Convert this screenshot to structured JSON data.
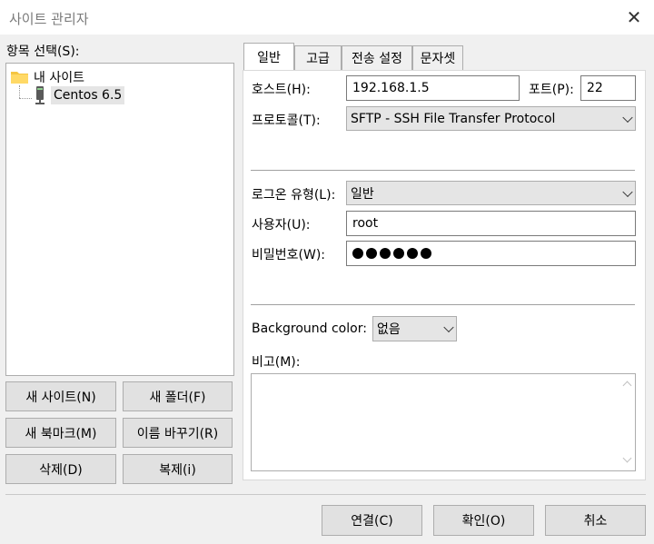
{
  "window": {
    "title": "사이트 관리자"
  },
  "left": {
    "select_label": "항목 선택(S):",
    "tree": {
      "folder": "내 사이트",
      "site": "Centos 6.5"
    },
    "buttons": {
      "new_site": "새 사이트(N)",
      "new_folder": "새 폴더(F)",
      "new_bookmark": "새 북마크(M)",
      "rename": "이름 바꾸기(R)",
      "delete": "삭제(D)",
      "duplicate": "복제(i)"
    }
  },
  "tabs": [
    "일반",
    "고급",
    "전송 설정",
    "문자셋"
  ],
  "general": {
    "host_label": "호스트(H):",
    "host_value": "192.168.1.5",
    "port_label": "포트(P):",
    "port_value": "22",
    "protocol_label": "프로토콜(T):",
    "protocol_value": "SFTP - SSH File Transfer Protocol",
    "logon_label": "로그온 유형(L):",
    "logon_value": "일반",
    "user_label": "사용자(U):",
    "user_value": "root",
    "password_label": "비밀번호(W):",
    "password_dots": 6,
    "bgcolor_label": "Background color:",
    "bgcolor_value": "없음",
    "comments_label": "비고(M):"
  },
  "footer": {
    "connect": "연결(C)",
    "ok": "확인(O)",
    "cancel": "취소"
  }
}
